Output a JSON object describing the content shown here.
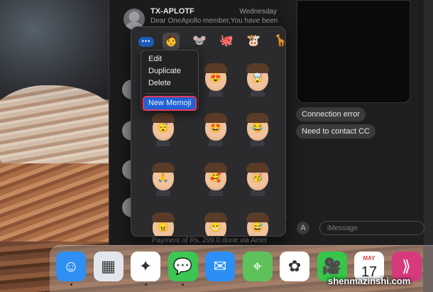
{
  "conversation": {
    "sender": "TX-APLOTF",
    "date": "Wednesday",
    "preview": "Dear OneApollo member,You have been"
  },
  "list_bottom_text": "Payment of Rs. 299.0 done via Airtel",
  "chat": {
    "bubbles": [
      "Connection error",
      "Need to contact CC"
    ],
    "input_placeholder": "iMessage"
  },
  "memoji_tabs": [
    {
      "name": "more-icon",
      "glyph": "•••"
    },
    {
      "name": "memoji-face-icon",
      "glyph": "🧑"
    },
    {
      "name": "mouse-icon",
      "glyph": "🐭"
    },
    {
      "name": "octopus-icon",
      "glyph": "🐙"
    },
    {
      "name": "cow-icon",
      "glyph": "🐮"
    },
    {
      "name": "giraffe-icon",
      "glyph": "🦒"
    }
  ],
  "stickers": [
    {
      "name": "heart-eyes",
      "expr": "😍"
    },
    {
      "name": "mind-blown",
      "expr": "🤯"
    },
    {
      "name": "sleeping",
      "expr": "😴"
    },
    {
      "name": "star-struck",
      "expr": "🤩"
    },
    {
      "name": "crying-laughing",
      "expr": "😂"
    },
    {
      "name": "praying",
      "expr": "🙏"
    },
    {
      "name": "hearts",
      "expr": "🥰"
    },
    {
      "name": "party",
      "expr": "🥳"
    },
    {
      "name": "angry",
      "expr": "😠"
    },
    {
      "name": "grimace",
      "expr": "😬"
    },
    {
      "name": "sweat",
      "expr": "😅"
    }
  ],
  "context_menu": {
    "items": [
      "Edit",
      "Duplicate",
      "Delete"
    ],
    "new_memoji": "New Memoji"
  },
  "dock": [
    {
      "name": "finder-icon",
      "glyph": "☺",
      "color": "#2f8ff2",
      "running": true
    },
    {
      "name": "launchpad-icon",
      "glyph": "▦",
      "color": "#e2e6ec",
      "running": false
    },
    {
      "name": "safari-icon",
      "glyph": "✦",
      "color": "#ffffff",
      "running": true
    },
    {
      "name": "messages-icon",
      "glyph": "💬",
      "color": "#3bc552",
      "running": true
    },
    {
      "name": "mail-icon",
      "glyph": "✉",
      "color": "#2c8ff5",
      "running": false
    },
    {
      "name": "maps-icon",
      "glyph": "⌖",
      "color": "#5fc15a",
      "running": false
    },
    {
      "name": "photos-icon",
      "glyph": "✿",
      "color": "#ffffff",
      "running": false
    },
    {
      "name": "facetime-icon",
      "glyph": "🎥",
      "color": "#36c64a",
      "running": false
    },
    {
      "name": "calendar-icon",
      "glyph": "17",
      "month": "MAY",
      "color": "#ffffff",
      "running": false
    },
    {
      "name": "shortcuts-icon",
      "glyph": "⟫",
      "color": "#d63a7c",
      "running": false
    }
  ],
  "watermark": "shenmazinshi.com"
}
